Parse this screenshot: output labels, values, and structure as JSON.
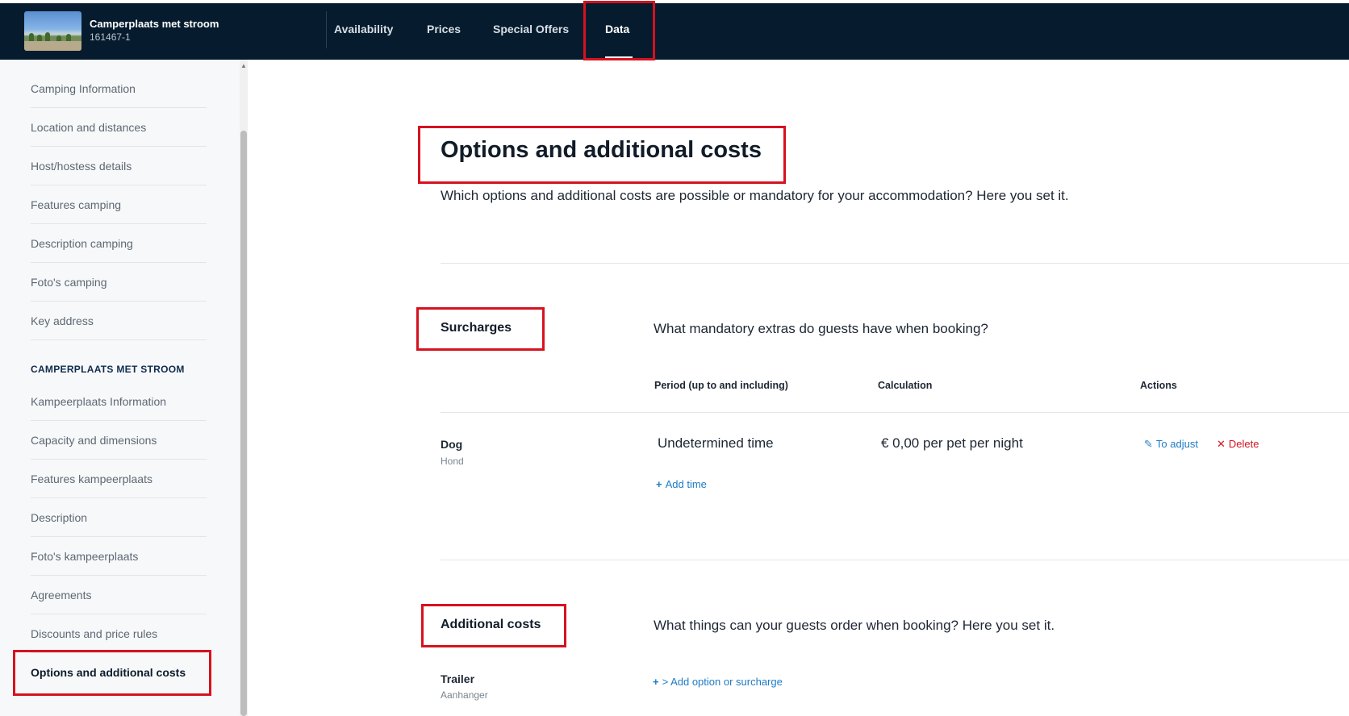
{
  "header": {
    "site_name": "Camperplaats met stroom",
    "site_id": "161467-1",
    "nav": [
      {
        "label": "Availability"
      },
      {
        "label": "Prices"
      },
      {
        "label": "Special Offers"
      },
      {
        "label": "Data",
        "active": true
      }
    ]
  },
  "sidebar": {
    "group1_items": [
      {
        "label": "Camping Information"
      },
      {
        "label": "Location and distances"
      },
      {
        "label": "Host/hostess details"
      },
      {
        "label": "Features camping"
      },
      {
        "label": "Description camping"
      },
      {
        "label": "Foto's camping"
      },
      {
        "label": "Key address"
      }
    ],
    "group2_heading": "CAMPERPLAATS MET STROOM",
    "group2_items": [
      {
        "label": "Kampeerplaats Information"
      },
      {
        "label": "Capacity and dimensions"
      },
      {
        "label": "Features kampeerplaats"
      },
      {
        "label": "Description"
      },
      {
        "label": "Foto's kampeerplaats"
      },
      {
        "label": "Agreements"
      },
      {
        "label": "Discounts and price rules"
      },
      {
        "label": "Options and additional costs",
        "active": true
      }
    ]
  },
  "main": {
    "title": "Options and additional costs",
    "subtitle": "Which options and additional costs are possible or mandatory for your accommodation? Here you set it.",
    "surcharges": {
      "title": "Surcharges",
      "description": "What mandatory extras do guests have when booking?",
      "columns": [
        "Period (up to and including)",
        "Calculation",
        "Actions"
      ],
      "rows": [
        {
          "name": "Dog",
          "sub": "Hond",
          "period": "Undetermined time",
          "calculation": "€ 0,00 per pet per night",
          "adjust_label": "To adjust",
          "delete_label": "Delete",
          "add_time_label": "Add time"
        }
      ]
    },
    "additional": {
      "title": "Additional costs",
      "description": "What things can your guests order when booking? Here you set it.",
      "rows": [
        {
          "name": "Trailer",
          "sub": "Aanhanger",
          "add_label": "> Add option or surcharge"
        }
      ]
    }
  },
  "colors": {
    "topbar": "#061c2e",
    "accent_link": "#1e7bc4",
    "danger": "#d6121f",
    "highlight_box": "#d6121f"
  },
  "icons": {
    "pencil": "pencil-icon",
    "close": "close-icon",
    "plus": "plus-icon",
    "scroll_up": "chevron-up-icon"
  }
}
